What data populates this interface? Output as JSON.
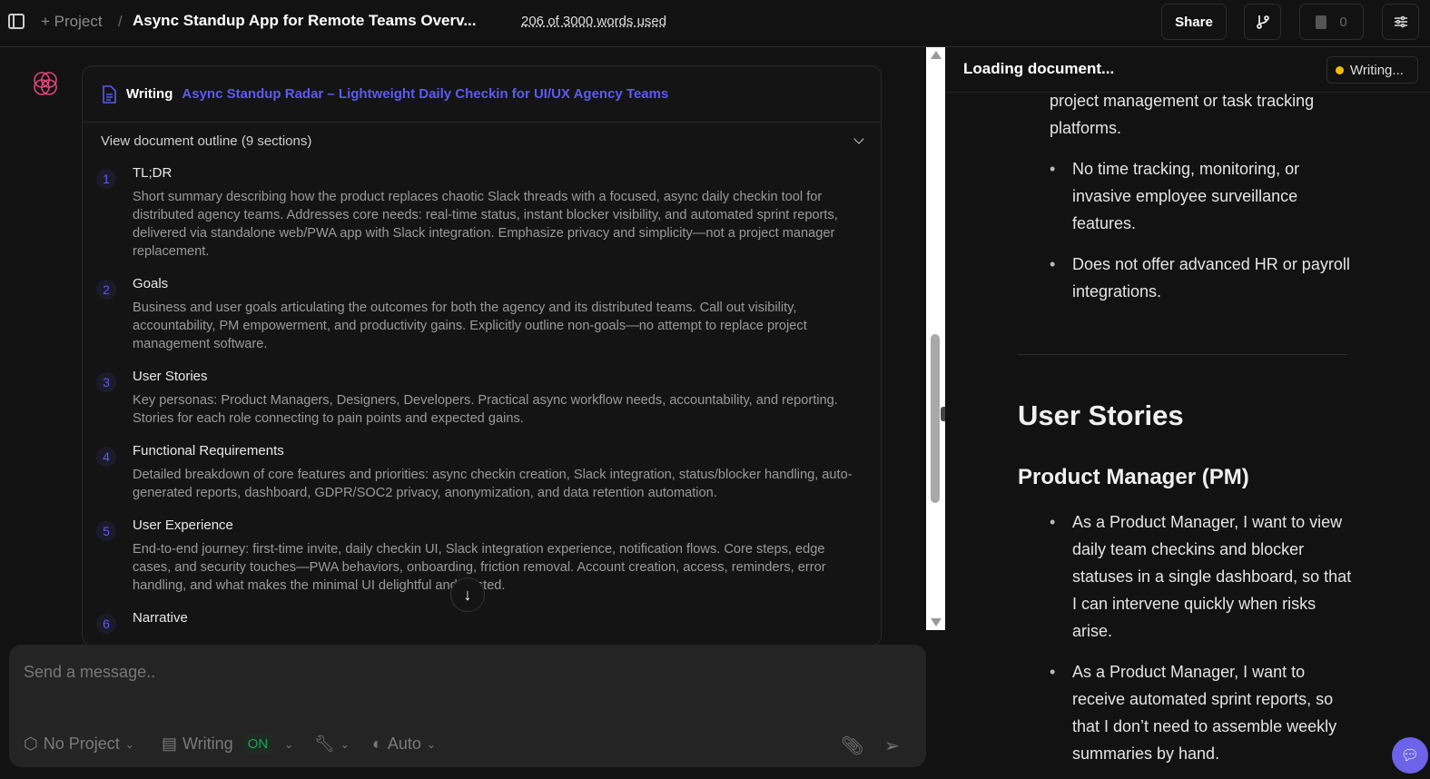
{
  "topbar": {
    "project": "+ Project",
    "separator": "/",
    "title": "Async Standup App for Remote Teams Overv...",
    "word_usage": "206 of 3000 words used",
    "share": "Share",
    "files_count": "0"
  },
  "chat": {
    "writing_label": "Writing",
    "doc_title": "Async Standup Radar – Lightweight Daily Checkin for UI/UX Agency Teams",
    "outline_toggle": "View document outline (9 sections)",
    "sections": [
      {
        "n": "1",
        "title": "TL;DR",
        "desc": "Short summary describing how the product replaces chaotic Slack threads with a focused, async daily checkin tool for distributed agency teams. Addresses core needs: real-time status, instant blocker visibility, and automated sprint reports, delivered via standalone web/PWA app with Slack integration. Emphasize privacy and simplicity—not a project manager replacement."
      },
      {
        "n": "2",
        "title": "Goals",
        "desc": "Business and user goals articulating the outcomes for both the agency and its distributed teams. Call out visibility, accountability, PM empowerment, and productivity gains. Explicitly outline non-goals—no attempt to replace project management software."
      },
      {
        "n": "3",
        "title": "User Stories",
        "desc": "Key personas: Product Managers, Designers, Developers. Practical async workflow needs, accountability, and reporting. Stories for each role connecting to pain points and expected gains."
      },
      {
        "n": "4",
        "title": "Functional Requirements",
        "desc": "Detailed breakdown of core features and priorities: async checkin creation, Slack integration, status/blocker handling, auto-generated reports, dashboard, GDPR/SOC2 privacy, anonymization, and data retention automation."
      },
      {
        "n": "5",
        "title": "User Experience",
        "desc": "End-to-end journey: first-time invite, daily checkin UI, Slack integration experience, notification flows. Core steps, edge cases, and security touches—PWA behaviors, onboarding, friction removal. Account creation, access, reminders, error handling, and what makes the minimal UI delightful and trusted."
      },
      {
        "n": "6",
        "title": "Narrative",
        "desc": ""
      }
    ]
  },
  "composer": {
    "placeholder": "Send a message..",
    "project": "No Project",
    "writing": "Writing",
    "writing_state": "ON",
    "model": "Auto"
  },
  "document": {
    "status_title": "Loading document...",
    "badge": "Writing...",
    "badge_color": "#f5b90a",
    "partial_text": "project management or task tracking platforms.",
    "bullets_top": [
      "No time tracking, monitoring, or invasive employee surveillance features.",
      "Does not offer advanced HR or payroll integrations."
    ],
    "h2": "User Stories",
    "h3": "Product Manager (PM)",
    "bullets_pm": [
      "As a Product Manager, I want to view daily team checkins and blocker statuses in a single dashboard, so that I can intervene quickly when risks arise.",
      "As a Product Manager, I want to receive automated sprint reports, so that I don’t need to assemble weekly summaries by hand."
    ]
  },
  "colors": {
    "accent": "#5b5bf0",
    "on": "#22a05a",
    "logo": "#e0457b"
  }
}
